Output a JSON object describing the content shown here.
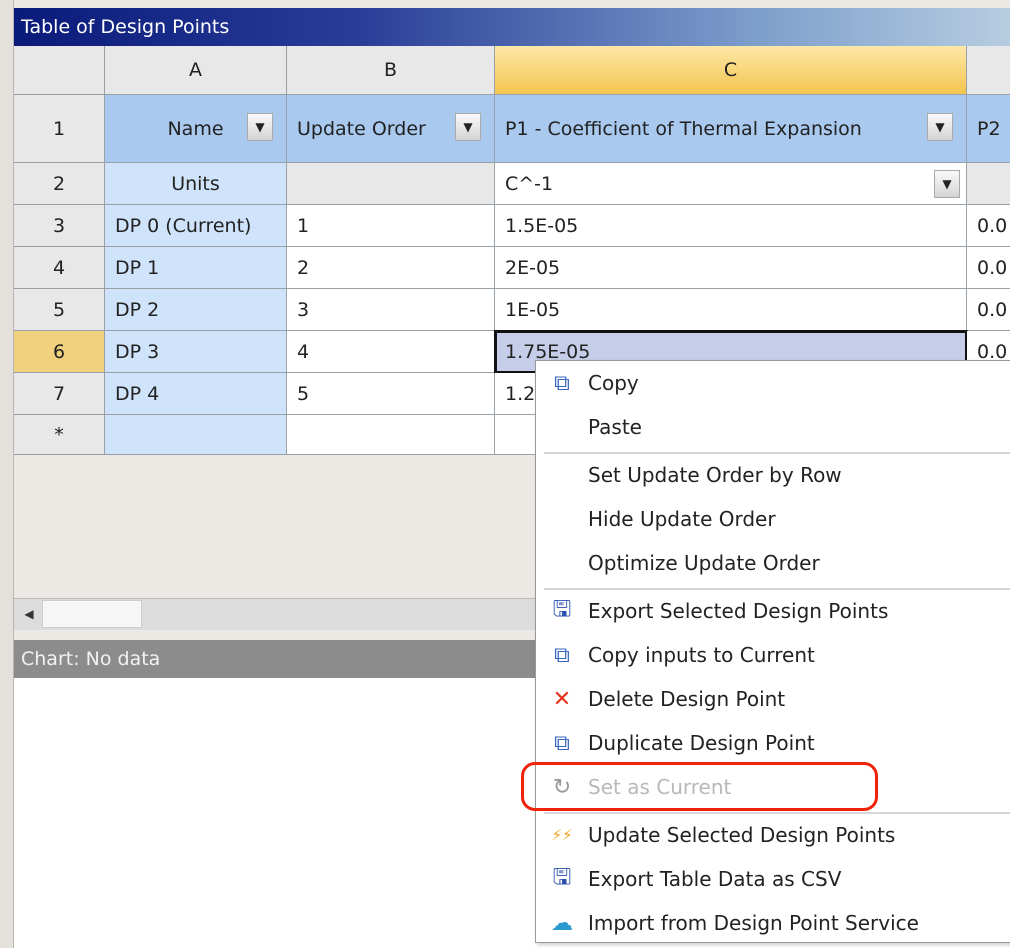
{
  "window": {
    "title": "Table of Design Points"
  },
  "columns": [
    "",
    "A",
    "B",
    "C",
    ""
  ],
  "header_row": {
    "num": "1",
    "cells": [
      "Name",
      "Update Order",
      "P1 - Coefficient of Thermal Expansion",
      "P2"
    ]
  },
  "units_row": {
    "num": "2",
    "label": "Units",
    "unit": "C^-1"
  },
  "rows": [
    {
      "num": "3",
      "name": "DP 0 (Current)",
      "order": "1",
      "p1": "1.5E-05",
      "p2": "0.0"
    },
    {
      "num": "4",
      "name": "DP 1",
      "order": "2",
      "p1": "2E-05",
      "p2": "0.0"
    },
    {
      "num": "5",
      "name": "DP 2",
      "order": "3",
      "p1": "1E-05",
      "p2": "0.0"
    },
    {
      "num": "6",
      "name": "DP 3",
      "order": "4",
      "p1": "1.75E-05",
      "p2": "0.0",
      "selected": true
    },
    {
      "num": "7",
      "name": "DP 4",
      "order": "5",
      "p1": "1.2",
      "p2": ""
    }
  ],
  "new_row": {
    "num": "*"
  },
  "chart": {
    "title": "Chart: No data"
  },
  "context_menu": {
    "items": [
      {
        "label": "Copy",
        "icon": "copy-icon"
      },
      {
        "label": "Paste",
        "icon": ""
      },
      {
        "sep": true
      },
      {
        "label": "Set Update Order by Row",
        "icon": ""
      },
      {
        "label": "Hide Update Order",
        "icon": ""
      },
      {
        "label": "Optimize Update Order",
        "icon": ""
      },
      {
        "sep": true
      },
      {
        "label": "Export Selected Design Points",
        "icon": "export-icon"
      },
      {
        "label": "Copy inputs to Current",
        "icon": "copy-icon"
      },
      {
        "label": "Delete Design Point",
        "icon": "delete-icon"
      },
      {
        "label": "Duplicate Design Point",
        "icon": "copy-icon"
      },
      {
        "label": "Set as Current",
        "icon": "set-current-icon",
        "disabled": true
      },
      {
        "sep": true
      },
      {
        "label": "Update Selected Design Points",
        "icon": "lightning-icon"
      },
      {
        "label": "Export Table Data as CSV",
        "icon": "export-icon"
      },
      {
        "label": "Import from Design Point Service",
        "icon": "cloud-import-icon"
      }
    ]
  },
  "colors": {
    "highlight": "#f0220a",
    "selected_column": "#f4c44e",
    "header_row": "#a9c9ef"
  }
}
